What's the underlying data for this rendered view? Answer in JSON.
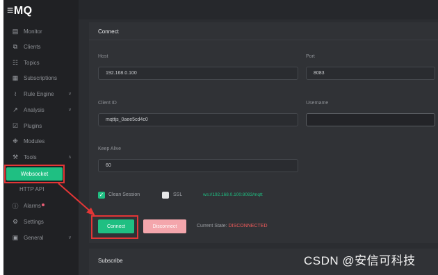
{
  "app": {
    "logo": "≡MQ"
  },
  "sidebar": {
    "items": [
      {
        "label": "Monitor",
        "icon": "monitor-icon",
        "glyph": "▤",
        "chevron": ""
      },
      {
        "label": "Clients",
        "icon": "clients-icon",
        "glyph": "⧉",
        "chevron": ""
      },
      {
        "label": "Topics",
        "icon": "topics-icon",
        "glyph": "☷",
        "chevron": ""
      },
      {
        "label": "Subscriptions",
        "icon": "subscriptions-icon",
        "glyph": "▦",
        "chevron": ""
      },
      {
        "label": "Rule Engine",
        "icon": "rule-engine-icon",
        "glyph": "≀",
        "chevron": "∨"
      },
      {
        "label": "Analysis",
        "icon": "analysis-icon",
        "glyph": "↗",
        "chevron": "∨"
      },
      {
        "label": "Plugins",
        "icon": "plugins-icon",
        "glyph": "☑",
        "chevron": ""
      },
      {
        "label": "Modules",
        "icon": "modules-icon",
        "glyph": "❉",
        "chevron": ""
      },
      {
        "label": "Tools",
        "icon": "tools-icon",
        "glyph": "⚒",
        "chevron": "∧"
      },
      {
        "label": "Websocket",
        "icon": "",
        "glyph": "",
        "chevron": ""
      },
      {
        "label": "HTTP API",
        "icon": "",
        "glyph": "",
        "chevron": ""
      },
      {
        "label": "Alarms",
        "icon": "alarms-icon",
        "glyph": "ⓘ",
        "chevron": ""
      },
      {
        "label": "Settings",
        "icon": "settings-icon",
        "glyph": "⚙",
        "chevron": ""
      },
      {
        "label": "General",
        "icon": "general-icon",
        "glyph": "▣",
        "chevron": "∨"
      }
    ]
  },
  "connect": {
    "title": "Connect",
    "host_label": "Host",
    "host_value": "192.168.0.100",
    "port_label": "Port",
    "port_value": "8083",
    "client_id_label": "Client ID",
    "client_id_value": "mqttjs_0aee5cd4c0",
    "username_label": "Username",
    "username_value": "",
    "keep_alive_label": "Keep Alive",
    "keep_alive_value": "60",
    "clean_session_label": "Clean Session",
    "clean_session_checked": true,
    "ssl_label": "SSL",
    "ssl_checked": false,
    "url": "ws://192.168.0.100:8083/mqtt",
    "connect_label": "Connect",
    "disconnect_label": "Disconnect",
    "state_label": "Current State:",
    "state_value": "DISCONNECTED"
  },
  "subscribe": {
    "title": "Subscribe"
  },
  "overlay": {
    "credit": "CSDN @安信可科技"
  },
  "colors": {
    "accent": "#1fbf82",
    "danger": "#f05b5b",
    "annotation": "#e33636"
  }
}
